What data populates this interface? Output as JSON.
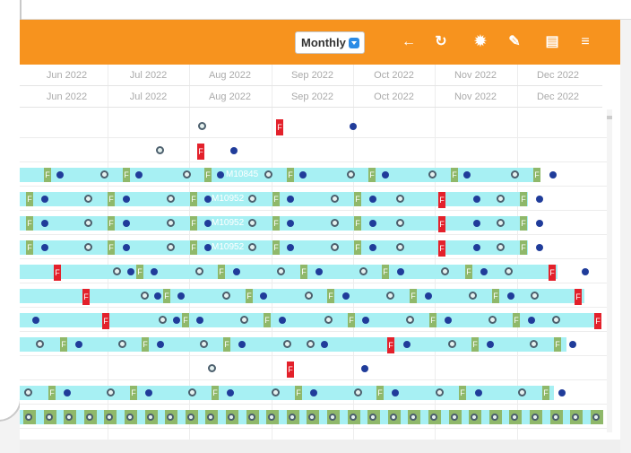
{
  "toolbar": {
    "view_select": "Monthly",
    "icons": [
      "back-arrow-icon",
      "refresh-icon",
      "gear-icon",
      "pencil-icon",
      "clipboard-icon",
      "list-icon"
    ]
  },
  "months_top": [
    "Jun 2022",
    "Jul 2022",
    "Aug 2022",
    "Sep 2022",
    "Oct 2022",
    "Nov 2022",
    "Dec 2022"
  ],
  "months_bottom": [
    "Jun 2022",
    "Jul 2022",
    "Aug 2022",
    "Sep 2022",
    "Oct 2022",
    "Nov 2022",
    "Dec 2022"
  ],
  "flag_letter": "F",
  "bar_labels": {
    "r3": "M10845",
    "r4": "M10952",
    "r5": "M10952",
    "r6": "M10952"
  },
  "colors": {
    "toolbar": "#f7931e",
    "bar": "#a7f0f3",
    "flag_green": "#8fb86a",
    "flag_red": "#e3212b",
    "dot": "#203c9a"
  }
}
